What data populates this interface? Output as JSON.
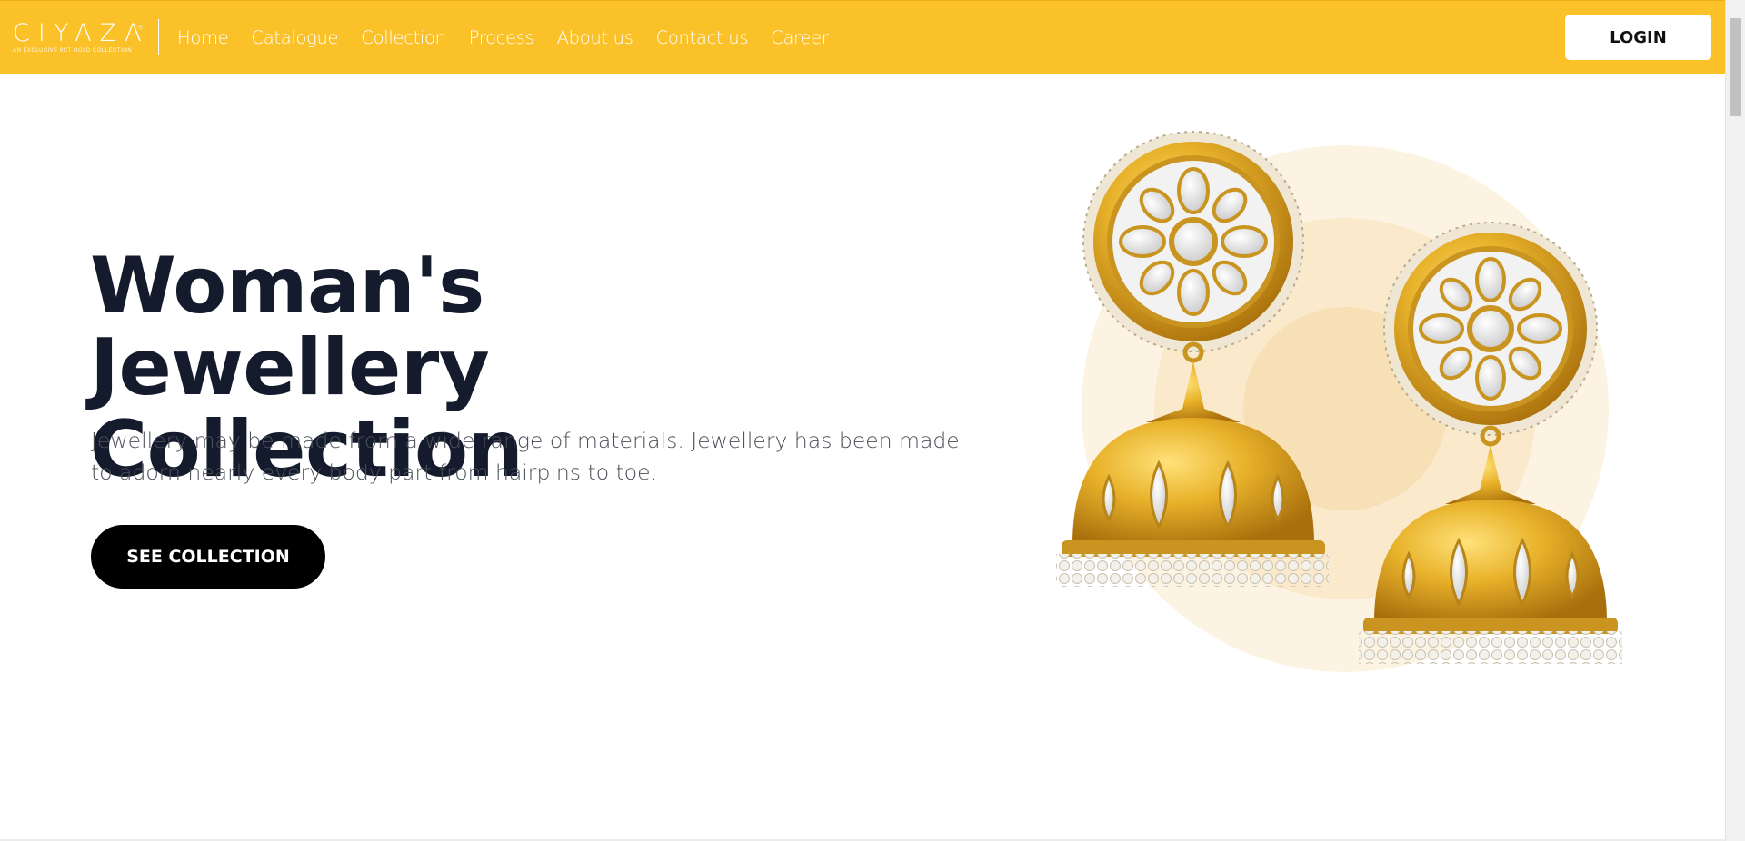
{
  "brand": {
    "name": "CIYAZA",
    "registered": "®",
    "tagline": "AN EXCLUSIVE 9CT GOLD COLLECTION"
  },
  "nav": {
    "links": [
      "Home",
      "Catalogue",
      "Collection",
      "Process",
      "About us",
      "Contact us",
      "Career"
    ],
    "login_label": "LOGIN"
  },
  "hero": {
    "title_line1": "Woman's Jewellery",
    "title_line2": "Collection",
    "description": "Jewellery may be made from a wide range of materials. Jewellery has been made to adorn nearly every body part from hairpins to toe.",
    "cta_label": "SEE COLLECTION",
    "image": "gold-jhumka-earrings-image"
  },
  "colors": {
    "navbar": "#fbc129",
    "title": "#141b2d",
    "cta": "#000000",
    "gold": "#d9a21b",
    "backdrop": "#fbe9c6"
  }
}
